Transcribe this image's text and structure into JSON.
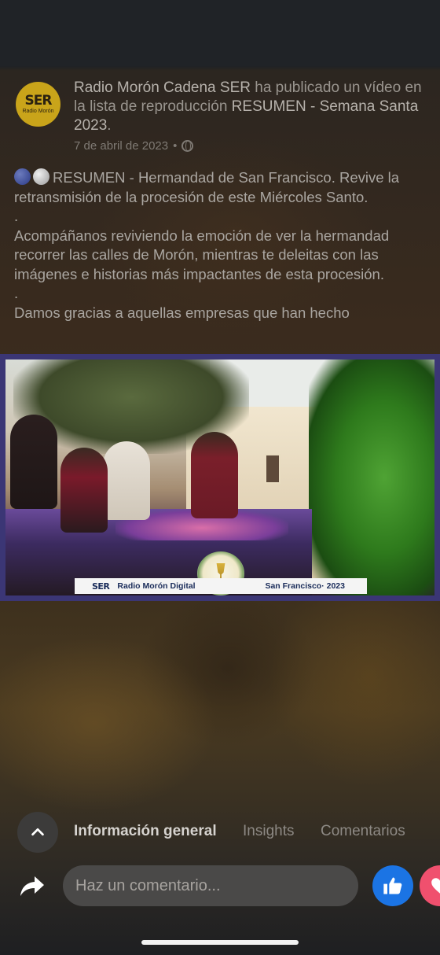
{
  "post": {
    "avatar": {
      "logo_main": "SER",
      "logo_sub": "Radio Morón"
    },
    "author": "Radio Morón Cadena SER",
    "action_text": "ha publicado un vídeo en la lista de reproducción",
    "playlist": "RESUMEN - Semana Santa 2023",
    "period": ".",
    "date": "7 de abril de 2023",
    "separator": "•",
    "privacy_icon": "globe-icon",
    "body": {
      "line1": "RESUMEN - Hermandad de San Francisco. Revive la retransmisión de la procesión de este Miércoles Santo.",
      "dot1": ".",
      "line2": "Acompáñanos reviviendo la emoción de ver la hermandad recorrer las calles de Morón, mientras te deleitas con las imágenes e historias más impactantes de esta procesión.",
      "dot2": ".",
      "line3": "Damos gracias a aquellas empresas que han hecho"
    }
  },
  "video": {
    "banner_logo": "SER",
    "banner_channel": "Radio Morón Digital",
    "banner_event": "San Francisco· 2023"
  },
  "tabs": {
    "collapse_icon": "chevron-up-icon",
    "items": [
      {
        "label": "Información general",
        "active": true
      },
      {
        "label": "Insights",
        "active": false
      },
      {
        "label": "Comentarios",
        "active": false
      }
    ]
  },
  "composer": {
    "share_icon": "share-icon",
    "placeholder": "Haz un comentario...",
    "like_icon": "thumbs-up-icon",
    "love_icon": "heart-icon",
    "like_color": "#1b74e4",
    "love_color": "#f0506e"
  }
}
